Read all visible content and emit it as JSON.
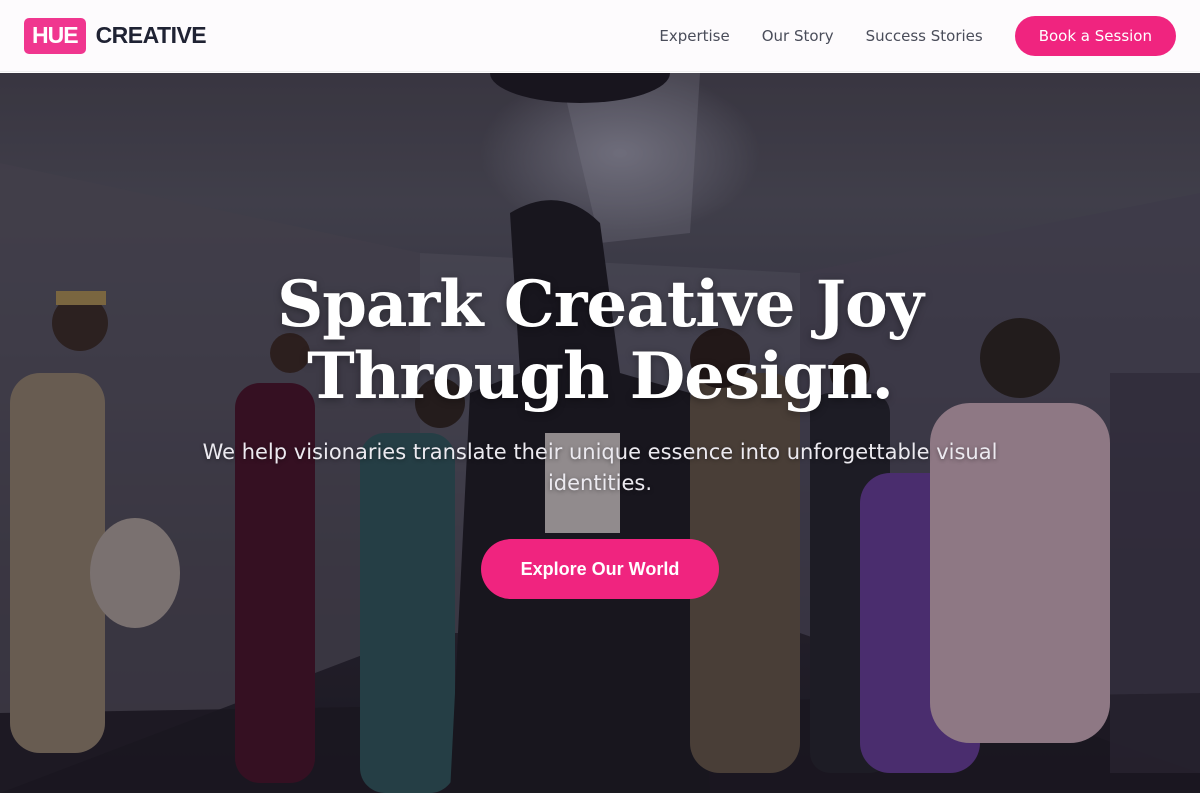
{
  "brand": {
    "badge": "HUE",
    "name": "CREATIVE",
    "accent_color": "#f0247f"
  },
  "nav": {
    "links": [
      "Expertise",
      "Our Story",
      "Success Stories"
    ],
    "cta_label": "Book a Session"
  },
  "hero": {
    "title_line1": "Spark Creative Joy",
    "title_line2": "Through Design.",
    "subtitle": "We help visionaries translate their unique essence into unforgettable visual identities.",
    "button_label": "Explore Our World"
  }
}
